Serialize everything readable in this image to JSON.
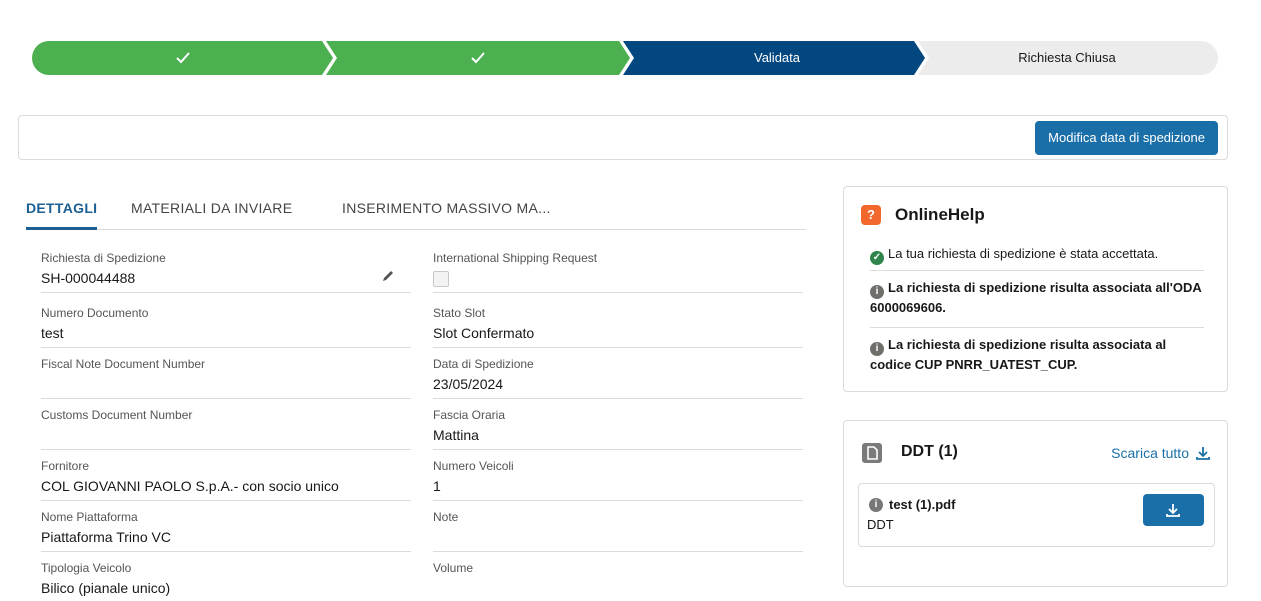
{
  "path": {
    "steps": [
      {
        "label": "",
        "status": "complete",
        "icon": "check-icon"
      },
      {
        "label": "",
        "status": "complete",
        "icon": "check-icon"
      },
      {
        "label": "Validata",
        "status": "current"
      },
      {
        "label": "Richiesta Chiusa",
        "status": "incomplete"
      }
    ],
    "colors": {
      "complete": "#4caf50",
      "current": "#034780",
      "incomplete": "#ececec"
    }
  },
  "action_bar": {
    "button_label": "Modifica data di spedizione"
  },
  "tabs": [
    {
      "label": "DETTAGLI",
      "active": true
    },
    {
      "label": "MATERIALI DA INVIARE",
      "active": false
    },
    {
      "label": "INSERIMENTO MASSIVO MA...",
      "active": false
    }
  ],
  "fields_left": [
    {
      "label": "Richiesta di Spedizione",
      "value": "SH-000044488",
      "editable": true
    },
    {
      "label": "Numero Documento",
      "value": "test"
    },
    {
      "label": "Fiscal Note Document Number",
      "value": ""
    },
    {
      "label": "Customs Document Number",
      "value": ""
    },
    {
      "label": "Fornitore",
      "value": "COL GIOVANNI PAOLO S.p.A.- con socio unico"
    },
    {
      "label": "Nome Piattaforma",
      "value": "Piattaforma Trino VC"
    },
    {
      "label": "Tipologia Veicolo",
      "value": "Bilico (pianale unico)"
    }
  ],
  "fields_right": [
    {
      "label": "International Shipping Request",
      "value": "",
      "checkbox": true,
      "checked": false
    },
    {
      "label": "Stato Slot",
      "value": "Slot Confermato"
    },
    {
      "label": "Data di Spedizione",
      "value": "23/05/2024"
    },
    {
      "label": "Fascia Oraria",
      "value": "Mattina"
    },
    {
      "label": "Numero Veicoli",
      "value": "1"
    },
    {
      "label": "Note",
      "value": ""
    },
    {
      "label": "Volume",
      "value": ""
    }
  ],
  "online_help": {
    "icon": "question-icon",
    "title": "OnlineHelp",
    "messages": [
      {
        "text": "La tua richiesta di spedizione è stata accettata.",
        "icon": "success-icon",
        "bold": false
      },
      {
        "text": "La richiesta di spedizione risulta associata all'ODA 6000069606.",
        "icon": "info-icon",
        "bold": true
      },
      {
        "text": "La richiesta di spedizione risulta associata al codice CUP PNRR_UATEST_CUP.",
        "icon": "info-icon",
        "bold": true
      }
    ]
  },
  "ddt": {
    "icon": "document-icon",
    "title": "DDT (1)",
    "download_all_label": "Scarica tutto",
    "file": {
      "name": "test (1).pdf",
      "type": "DDT"
    }
  }
}
